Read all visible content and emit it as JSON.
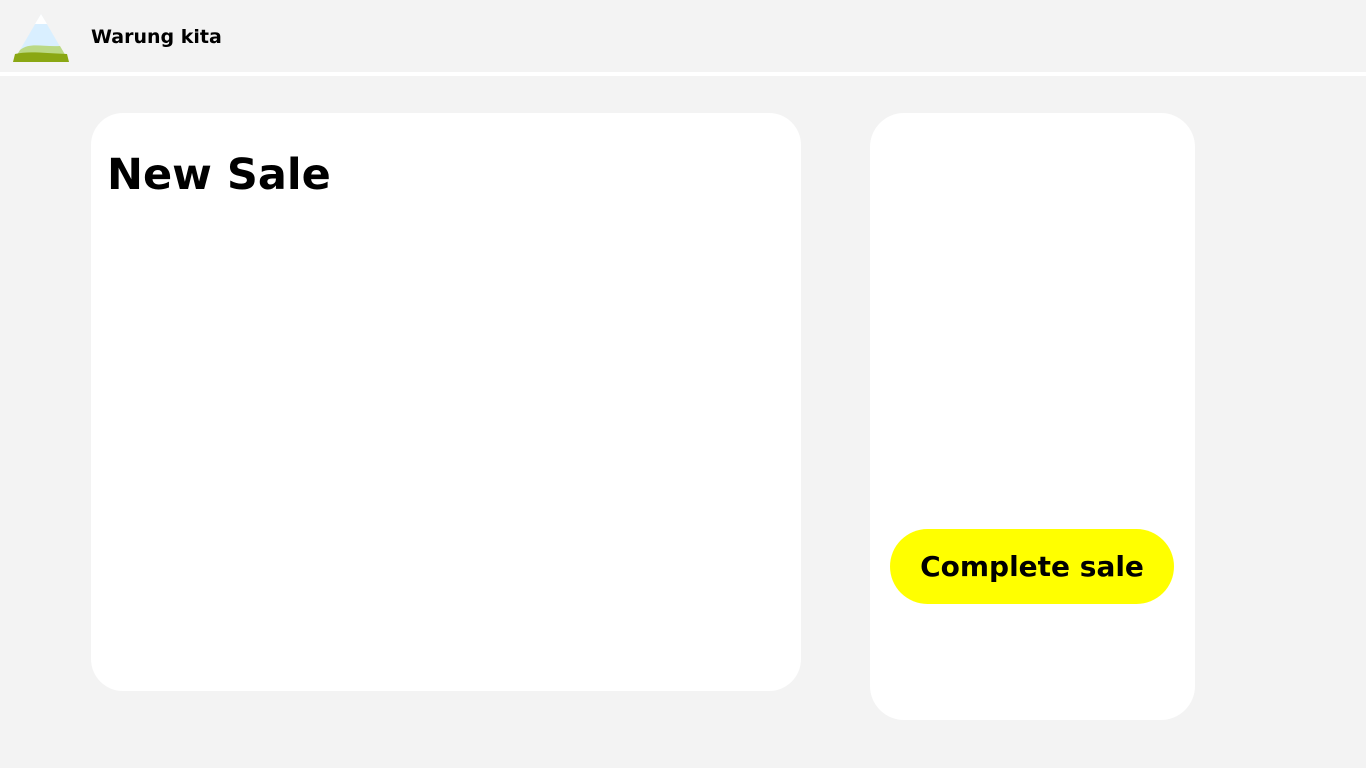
{
  "header": {
    "logo_icon": "mountain-logo-icon",
    "store_name": "Warung kita"
  },
  "new_sale_panel": {
    "title": "New Sale"
  },
  "side_panel": {
    "complete_sale_label": "Complete sale"
  },
  "colors": {
    "page_background": "#f3f3f3",
    "panel_background": "#ffffff",
    "primary_button": "#ffff00",
    "text": "#000000",
    "logo_green": "#8aa713",
    "logo_light_green": "#bbd985",
    "logo_sky": "#d9efff"
  }
}
